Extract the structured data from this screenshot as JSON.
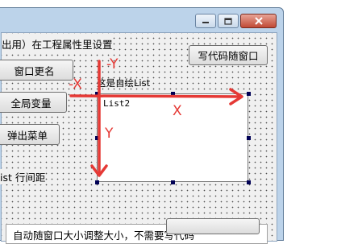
{
  "window": {
    "controls": {
      "minimize": "minimize",
      "maximize": "maximize",
      "close": "close"
    }
  },
  "form": {
    "top_label": "出用）在工程属性里设置",
    "write_code_button": "写代码随窗口",
    "rename_button": "窗口更名",
    "global_var_button": "全局变量",
    "popup_menu_button": "弹出菜单",
    "list_spacing_label": "ist 行间距",
    "owner_draw_label": "这是自绘List",
    "list_item": "List2",
    "auto_resize_text": "自动随窗口大小调整大小，不需要写代码"
  },
  "annotations": {
    "neg_x": "-X",
    "neg_y": "-Y",
    "x": "X",
    "y": "Y",
    "color": "#e53935"
  }
}
